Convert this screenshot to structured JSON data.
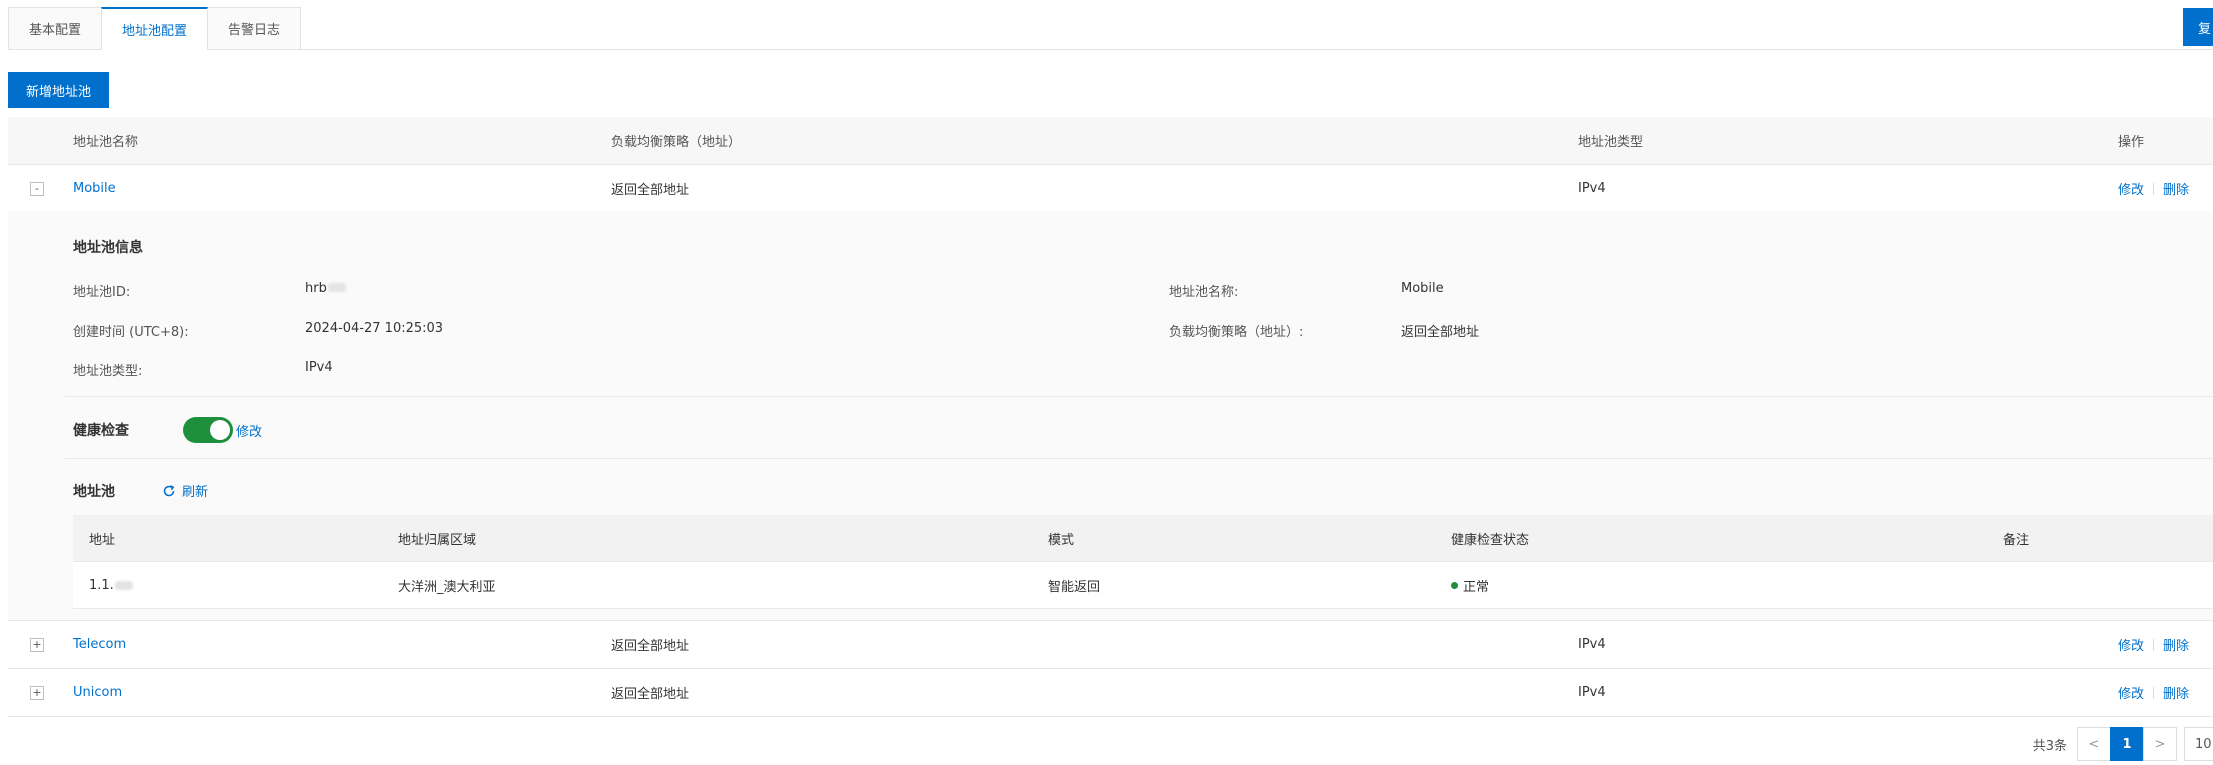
{
  "tabs": [
    {
      "label": "基本配置",
      "active": false
    },
    {
      "label": "地址池配置",
      "active": true
    },
    {
      "label": "告警日志",
      "active": false
    }
  ],
  "top_right_button": "复",
  "add_button": "新增地址池",
  "table": {
    "headers": {
      "name": "地址池名称",
      "policy": "负载均衡策略（地址）",
      "type": "地址池类型",
      "ops": "操作"
    },
    "rows": [
      {
        "expand": "-",
        "name": "Mobile",
        "policy": "返回全部地址",
        "type": "IPv4",
        "edit": "修改",
        "delete": "删除"
      },
      {
        "expand": "+",
        "name": "Telecom",
        "policy": "返回全部地址",
        "type": "IPv4",
        "edit": "修改",
        "delete": "删除"
      },
      {
        "expand": "+",
        "name": "Unicom",
        "policy": "返回全部地址",
        "type": "IPv4",
        "edit": "修改",
        "delete": "删除"
      }
    ]
  },
  "detail": {
    "info_title": "地址池信息",
    "id_label": "地址池ID:",
    "id_value": "hrb",
    "name_label": "地址池名称:",
    "name_value": "Mobile",
    "created_label": "创建时间 (UTC+8):",
    "created_value": "2024-04-27 10:25:03",
    "policy_label": "负载均衡策略（地址）:",
    "policy_value": "返回全部地址",
    "type_label": "地址池类型:",
    "type_value": "IPv4",
    "health_title": "健康检查",
    "health_enabled": true,
    "health_edit": "修改",
    "pool_title": "地址池",
    "refresh_label": "刷新",
    "sub_headers": {
      "address": "地址",
      "region": "地址归属区域",
      "mode": "模式",
      "health": "健康检查状态",
      "note": "备注"
    },
    "sub_rows": [
      {
        "address": "1.1.",
        "region": "大洋洲_澳大利亚",
        "mode": "智能返回",
        "health": "正常",
        "note": ""
      }
    ]
  },
  "pagination": {
    "total": "共3条",
    "prev": "<",
    "current": "1",
    "next": ">",
    "page_size": "10"
  },
  "colors": {
    "primary": "#0070cc",
    "success": "#1d8f3d"
  }
}
